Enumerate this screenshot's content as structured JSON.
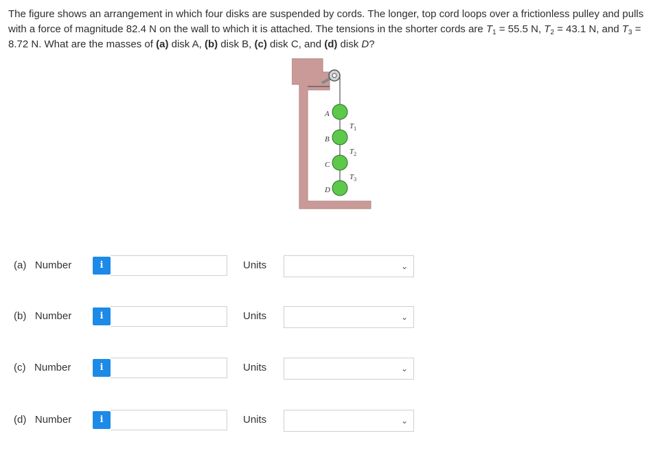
{
  "question": {
    "s1": "The figure shows an arrangement in which four disks are suspended by cords. The longer, top cord loops over a frictionless pulley and pulls with a force of magnitude 82.4 N on the wall to which it is attached. The tensions in the shorter cords are ",
    "t1": "T",
    "t1sub": "1",
    "v1": " = 55.5 N, ",
    "t2": "T",
    "t2sub": "2",
    "v2": " = 43.1 N, and ",
    "t3": "T",
    "t3sub": "3",
    "v3": " = 8.72 N. What are the masses of ",
    "pa": "(a)",
    "ta": " disk A, ",
    "pb": "(b)",
    "tb": " disk B, ",
    "pc": "(c)",
    "tc": " disk C, and ",
    "pd": "(d)",
    "td": " disk ",
    "dlast": "D",
    "qmark": "?"
  },
  "figure": {
    "disk_labels": [
      "A",
      "B",
      "C",
      "D"
    ],
    "tension_labels": [
      {
        "T": "T",
        "sub": "1"
      },
      {
        "T": "T",
        "sub": "2"
      },
      {
        "T": "T",
        "sub": "3"
      }
    ],
    "colors": {
      "wall": "#c99a98",
      "disk": "#5cc94a",
      "disk_edge": "#2e6b2a",
      "cord": "#555555"
    }
  },
  "rows": [
    {
      "part": "(a)",
      "label": "Number",
      "info_icon": "i",
      "value": "",
      "units_label": "Units",
      "units_value": ""
    },
    {
      "part": "(b)",
      "label": "Number",
      "info_icon": "i",
      "value": "",
      "units_label": "Units",
      "units_value": ""
    },
    {
      "part": "(c)",
      "label": "Number",
      "info_icon": "i",
      "value": "",
      "units_label": "Units",
      "units_value": ""
    },
    {
      "part": "(d)",
      "label": "Number",
      "info_icon": "i",
      "value": "",
      "units_label": "Units",
      "units_value": ""
    }
  ],
  "colors": {
    "info_button": "#1c8ae6",
    "input_border": "#cfcfcf"
  }
}
